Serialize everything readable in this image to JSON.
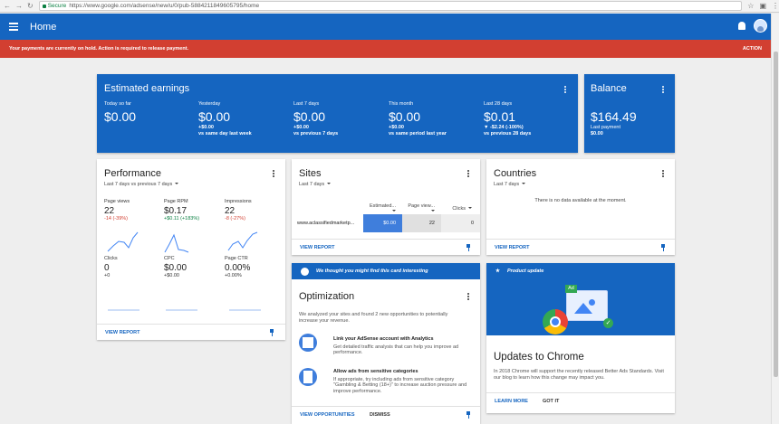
{
  "browser": {
    "secure": "Secure",
    "url": "https://www.google.com/adsense/new/u/0/pub-5884211849605795/home"
  },
  "appbar": {
    "title": "Home"
  },
  "alert": {
    "message": "Your payments are currently on hold. Action is required to release payment.",
    "action": "ACTION"
  },
  "earnings": {
    "title": "Estimated earnings",
    "items": [
      {
        "label": "Today so far",
        "value": "$0.00",
        "delta": "",
        "compare": ""
      },
      {
        "label": "Yesterday",
        "value": "$0.00",
        "delta": "+$0.00",
        "compare": "vs same day last week"
      },
      {
        "label": "Last 7 days",
        "value": "$0.00",
        "delta": "+$0.00",
        "compare": "vs previous 7 days"
      },
      {
        "label": "This month",
        "value": "$0.00",
        "delta": "+$0.00",
        "compare": "vs same period last year"
      },
      {
        "label": "Last 28 days",
        "value": "$0.01",
        "delta": "▼ -$2.24 (-100%)",
        "compare": "vs previous 28 days"
      }
    ]
  },
  "balance": {
    "title": "Balance",
    "value": "$164.49",
    "last_label": "Last payment",
    "last_value": "$0.00"
  },
  "performance": {
    "title": "Performance",
    "range": "Last 7 days vs previous 7 days",
    "metrics": [
      {
        "label": "Page views",
        "value": "22",
        "delta": "-14 (-39%)",
        "tone": "red"
      },
      {
        "label": "Page RPM",
        "value": "$0.17",
        "delta": "+$0.11 (+183%)",
        "tone": "green"
      },
      {
        "label": "Impressions",
        "value": "22",
        "delta": "-8 (-27%)",
        "tone": "red"
      },
      {
        "label": "Clicks",
        "value": "0",
        "delta": "+0",
        "tone": "neutral"
      },
      {
        "label": "CPC",
        "value": "$0.00",
        "delta": "+$0.00",
        "tone": "neutral"
      },
      {
        "label": "Page CTR",
        "value": "0.00%",
        "delta": "+0.00%",
        "tone": "neutral"
      }
    ],
    "link": "VIEW REPORT"
  },
  "sites": {
    "title": "Sites",
    "range": "Last 7 days",
    "columns": [
      "Estimated...",
      "Page view...",
      "Clicks"
    ],
    "row": {
      "site": "www.aclassifiedmarketp...",
      "earnings": "$0.00",
      "views": "22",
      "clicks": "0"
    },
    "link": "VIEW REPORT"
  },
  "countries": {
    "title": "Countries",
    "range": "Last 7 days",
    "empty": "There is no data available at the moment.",
    "link": "VIEW REPORT"
  },
  "optimization": {
    "banner": "We thought you might find this card interesting",
    "title": "Optimization",
    "intro": "We analyzed your sites and found 2 new opportunities to potentially increase your revenue.",
    "items": [
      {
        "title": "Link your AdSense account with Analytics",
        "text": "Get detailed traffic analysis that can help you improve ad performance."
      },
      {
        "title": "Allow ads from sensitive categories",
        "text": "If appropriate, try including ads from sensitive category \"Gambling & Betting (18+)\" to increase auction pressure and improve performance."
      }
    ],
    "primary": "VIEW OPPORTUNITIES",
    "secondary": "DISMISS"
  },
  "product": {
    "banner": "Product update",
    "ad_badge": "Ad",
    "title": "Updates to Chrome",
    "text": "In 2018 Chrome will support the recently released Better Ads Standards. Visit our blog to learn how this change may impact you.",
    "primary": "LEARN MORE",
    "secondary": "GOT IT"
  },
  "colors": {
    "brand": "#1565c0",
    "alert": "#d23f31",
    "positive": "#0b8043"
  }
}
